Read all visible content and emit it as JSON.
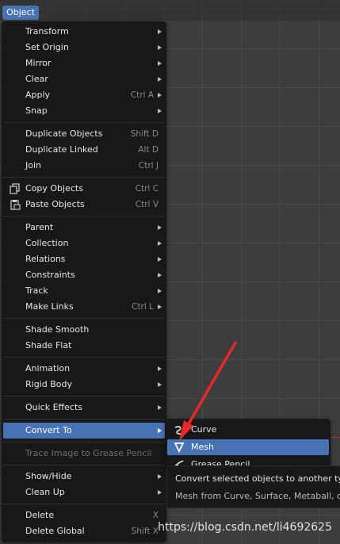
{
  "menu_button": {
    "label": "Object"
  },
  "main_menu": {
    "groups": [
      [
        {
          "label": "Transform",
          "submenu": true
        },
        {
          "label": "Set Origin",
          "submenu": true
        },
        {
          "label": "Mirror",
          "submenu": true
        },
        {
          "label": "Clear",
          "submenu": true
        },
        {
          "label": "Apply",
          "shortcut": "Ctrl A",
          "submenu": true
        },
        {
          "label": "Snap",
          "submenu": true
        }
      ],
      [
        {
          "label": "Duplicate Objects",
          "shortcut": "Shift D"
        },
        {
          "label": "Duplicate Linked",
          "shortcut": "Alt D"
        },
        {
          "label": "Join",
          "shortcut": "Ctrl J"
        }
      ],
      [
        {
          "label": "Copy Objects",
          "shortcut": "Ctrl C",
          "icon": "copy-icon"
        },
        {
          "label": "Paste Objects",
          "shortcut": "Ctrl V",
          "icon": "paste-icon"
        }
      ],
      [
        {
          "label": "Parent",
          "submenu": true
        },
        {
          "label": "Collection",
          "submenu": true
        },
        {
          "label": "Relations",
          "submenu": true
        },
        {
          "label": "Constraints",
          "submenu": true
        },
        {
          "label": "Track",
          "submenu": true
        },
        {
          "label": "Make Links",
          "shortcut": "Ctrl L",
          "submenu": true
        }
      ],
      [
        {
          "label": "Shade Smooth"
        },
        {
          "label": "Shade Flat"
        }
      ],
      [
        {
          "label": "Animation",
          "submenu": true
        },
        {
          "label": "Rigid Body",
          "submenu": true
        }
      ],
      [
        {
          "label": "Quick Effects",
          "submenu": true
        }
      ],
      [
        {
          "label": "Convert To",
          "submenu": true,
          "highlighted": true
        }
      ],
      [
        {
          "label": "Trace Image to Grease Pencil",
          "disabled": true
        }
      ],
      [
        {
          "label": "Show/Hide",
          "submenu": true
        },
        {
          "label": "Clean Up",
          "submenu": true
        }
      ],
      [
        {
          "label": "Delete",
          "shortcut": "X"
        },
        {
          "label": "Delete Global",
          "shortcut": "Shift X"
        }
      ]
    ]
  },
  "submenu": {
    "items": [
      {
        "label": "Curve",
        "icon": "curve-icon"
      },
      {
        "label": "Mesh",
        "icon": "mesh-icon",
        "highlighted": true
      },
      {
        "label": "Grease Pencil",
        "icon": "grease-pencil-icon"
      }
    ]
  },
  "tooltip": {
    "title": "Convert selected objects to another type:",
    "detail": "Mesh from Curve, Surface, Metaball, or Text objects"
  },
  "watermark": "https://blog.csdn.net/li4692625",
  "colors": {
    "highlight": "#4772b3",
    "menu_bg": "#181818",
    "viewport_bg": "#3d3d3d",
    "annotation_arrow": "#e8282b"
  }
}
